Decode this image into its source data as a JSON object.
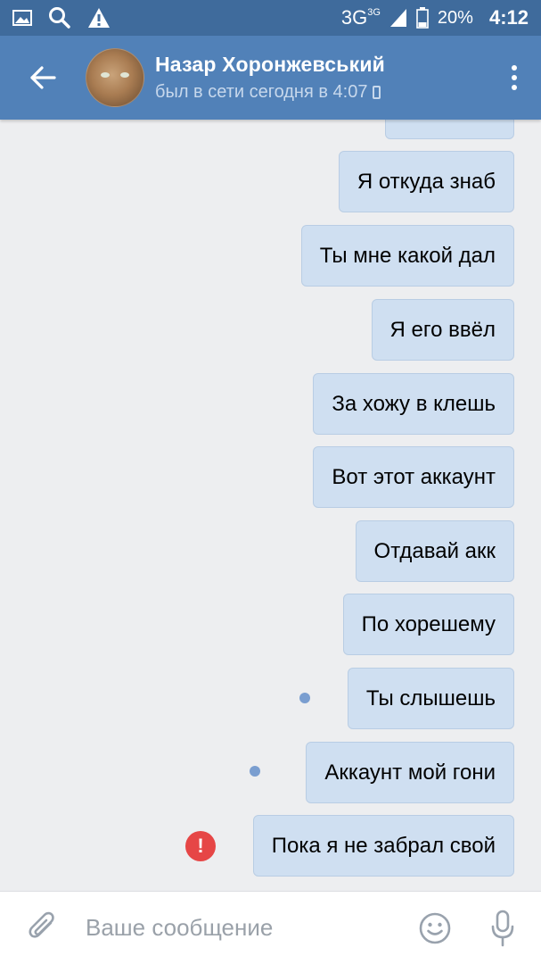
{
  "status_bar": {
    "network": "3G",
    "network_sup": "3G",
    "battery": "20%",
    "time": "4:12",
    "icons": [
      "gallery-icon",
      "search-icon",
      "warning-icon",
      "signal-icon",
      "battery-icon"
    ]
  },
  "header": {
    "contact_name": "Назар Хоронжевський",
    "last_seen": "был в сети сегодня в 4:07"
  },
  "messages": [
    {
      "text": "Я откуда знаб",
      "status": "sent"
    },
    {
      "text": "Ты мне какой дал",
      "status": "sent"
    },
    {
      "text": "Я его ввёл",
      "status": "sent"
    },
    {
      "text": "За хожу в клешь",
      "status": "sent"
    },
    {
      "text": "Вот этот аккаунт",
      "status": "sent"
    },
    {
      "text": "Отдавай акк",
      "status": "sent"
    },
    {
      "text": "По хорешему",
      "status": "sent"
    },
    {
      "text": "Ты слышешь",
      "status": "unread"
    },
    {
      "text": "Аккаунт мой гони",
      "status": "unread"
    },
    {
      "text": "Пока я не забрал свой",
      "status": "error"
    }
  ],
  "composer": {
    "placeholder": "Ваше сообщение"
  },
  "colors": {
    "status_bar": "#3f6b9c",
    "app_bar": "#5181b8",
    "bubble": "#cfdff1",
    "background": "#edeef0",
    "error": "#e64646",
    "unread_dot": "#7a9ed0"
  }
}
